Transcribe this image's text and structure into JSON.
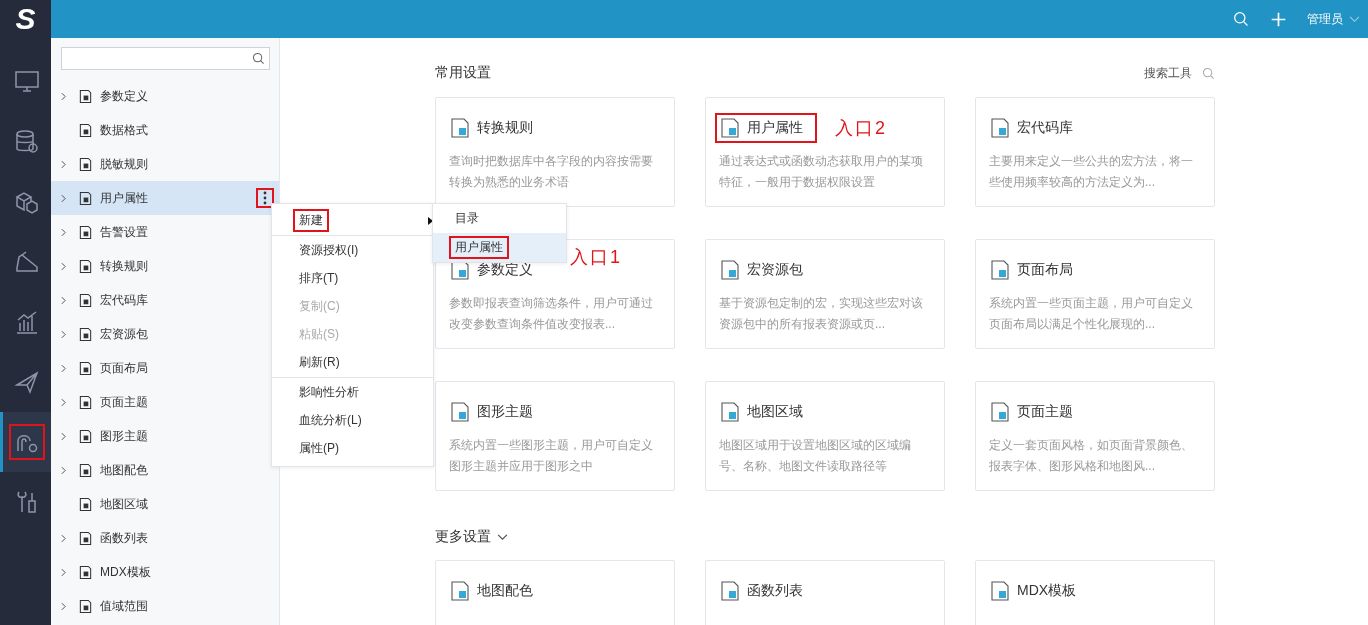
{
  "logo": {
    "text": "S"
  },
  "top_bar": {
    "user": "管理员"
  },
  "rail": [
    {
      "selected": false,
      "annotated": false
    },
    {
      "selected": false,
      "annotated": false
    },
    {
      "selected": false,
      "annotated": false
    },
    {
      "selected": false,
      "annotated": false
    },
    {
      "selected": false,
      "annotated": false
    },
    {
      "selected": false,
      "annotated": false
    },
    {
      "selected": true,
      "annotated": true
    },
    {
      "selected": false,
      "annotated": false
    }
  ],
  "tree": {
    "items": [
      {
        "label": "参数定义",
        "expandable": true,
        "selected": false
      },
      {
        "label": "数据格式",
        "expandable": false,
        "selected": false
      },
      {
        "label": "脱敏规则",
        "expandable": true,
        "selected": false
      },
      {
        "label": "用户属性",
        "expandable": true,
        "selected": true
      },
      {
        "label": "告警设置",
        "expandable": true,
        "selected": false
      },
      {
        "label": "转换规则",
        "expandable": true,
        "selected": false
      },
      {
        "label": "宏代码库",
        "expandable": true,
        "selected": false
      },
      {
        "label": "宏资源包",
        "expandable": true,
        "selected": false
      },
      {
        "label": "页面布局",
        "expandable": true,
        "selected": false
      },
      {
        "label": "页面主题",
        "expandable": true,
        "selected": false
      },
      {
        "label": "图形主题",
        "expandable": true,
        "selected": false
      },
      {
        "label": "地图配色",
        "expandable": true,
        "selected": false
      },
      {
        "label": "地图区域",
        "expandable": false,
        "selected": false
      },
      {
        "label": "函数列表",
        "expandable": true,
        "selected": false
      },
      {
        "label": "MDX模板",
        "expandable": true,
        "selected": false
      },
      {
        "label": "值域范围",
        "expandable": true,
        "selected": false
      }
    ]
  },
  "context_menu": {
    "items": [
      {
        "label": "新建",
        "disabled": false,
        "annotated": true,
        "has_submenu": true,
        "divider_after": true
      },
      {
        "label": "资源授权(I)",
        "disabled": false,
        "annotated": false,
        "has_submenu": false,
        "divider_after": false
      },
      {
        "label": "排序(T)",
        "disabled": false,
        "annotated": false,
        "has_submenu": false,
        "divider_after": false
      },
      {
        "label": "复制(C)",
        "disabled": true,
        "annotated": false,
        "has_submenu": false,
        "divider_after": false
      },
      {
        "label": "粘贴(S)",
        "disabled": true,
        "annotated": false,
        "has_submenu": false,
        "divider_after": false
      },
      {
        "label": "刷新(R)",
        "disabled": false,
        "annotated": false,
        "has_submenu": false,
        "divider_after": true
      },
      {
        "label": "影响性分析",
        "disabled": false,
        "annotated": false,
        "has_submenu": false,
        "divider_after": false
      },
      {
        "label": "血统分析(L)",
        "disabled": false,
        "annotated": false,
        "has_submenu": false,
        "divider_after": false
      },
      {
        "label": "属性(P)",
        "disabled": false,
        "annotated": false,
        "has_submenu": false,
        "divider_after": false
      }
    ],
    "submenu": [
      {
        "label": "目录",
        "selected": false,
        "annotated": false
      },
      {
        "label": "用户属性",
        "selected": true,
        "annotated": true
      }
    ],
    "note": "入口1"
  },
  "search_tool": {
    "label": "搜索工具"
  },
  "sections": [
    {
      "title": "常用设置",
      "kind": "fixed",
      "cards": [
        {
          "title": "转换规则",
          "description": "查询时把数据库中各字段的内容按需要转换为熟悉的业务术语",
          "annotated": false
        },
        {
          "title": "用户属性",
          "description": "通过表达式或函数动态获取用户的某项特征，一般用于数据权限设置",
          "annotated": true,
          "note": "入口2"
        },
        {
          "title": "宏代码库",
          "description": "主要用来定义一些公共的宏方法，将一些使用频率较高的方法定义为...",
          "annotated": false
        },
        {
          "title": "参数定义",
          "description": "参数即报表查询筛选条件，用户可通过改变参数查询条件值改变报表...",
          "annotated": false
        },
        {
          "title": "宏资源包",
          "description": "基于资源包定制的宏，实现这些宏对该资源包中的所有报表资源或页...",
          "annotated": false
        },
        {
          "title": "页面布局",
          "description": "系统内置一些页面主题，用户可自定义页面布局以满足个性化展现的...",
          "annotated": false
        },
        {
          "title": "图形主题",
          "description": "系统内置一些图形主题，用户可自定义图形主题并应用于图形之中",
          "annotated": false
        },
        {
          "title": "地图区域",
          "description": "地图区域用于设置地图区域的区域编号、名称、地图文件读取路径等",
          "annotated": false
        },
        {
          "title": "页面主题",
          "description": "定义一套页面风格，如页面背景颜色、报表字体、图形风格和地图风...",
          "annotated": false
        }
      ]
    },
    {
      "title": "更多设置",
      "kind": "collapsible",
      "cards": [
        {
          "title": "地图配色",
          "annotated": false
        },
        {
          "title": "函数列表",
          "annotated": false
        },
        {
          "title": "MDX模板",
          "annotated": false
        }
      ]
    }
  ]
}
